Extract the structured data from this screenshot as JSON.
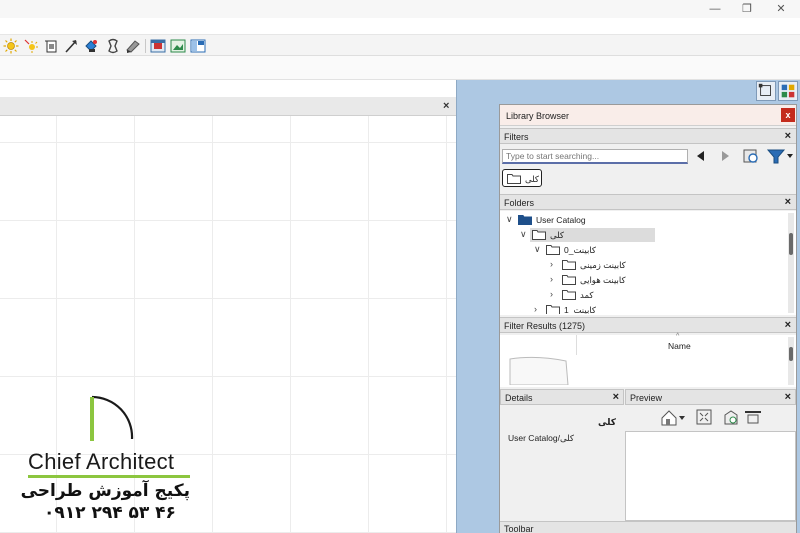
{
  "window": {
    "minimize_glyph": "—",
    "maximize_glyph": "❐",
    "close_glyph": "✕"
  },
  "toolbar": {
    "icons": [
      "sun-light-icon",
      "spot-light-icon",
      "camera-add-icon",
      "arrow-pointer-icon",
      "paint-bucket-icon",
      "material-eyedropper-icon",
      "pencil-ruler-icon",
      "render-view-icon",
      "image-view-icon",
      "layout-view-icon"
    ]
  },
  "drawing": {
    "close_glyph": "×"
  },
  "library": {
    "title": "Library Browser",
    "close_glyph": "x",
    "filters": {
      "label": "Filters",
      "search_placeholder": "Type to start searching...",
      "chip_label": "کلی"
    },
    "folders": {
      "label": "Folders",
      "items": [
        {
          "label": "User Catalog",
          "caret": "∨"
        },
        {
          "label": "کلی",
          "caret": "∨"
        },
        {
          "label": "کابینت_0",
          "caret": "∨"
        },
        {
          "label": "کابینت زمینی",
          "caret": "›"
        },
        {
          "label": "کابینت هوایی",
          "caret": "›"
        },
        {
          "label": "کمد",
          "caret": "›"
        },
        {
          "label": "کابینت_1",
          "caret": "›"
        }
      ]
    },
    "results": {
      "label": "Filter Results (1275)",
      "column_name": "Name",
      "sort_glyph": "^"
    },
    "details": {
      "label": "Details",
      "title": "کلی",
      "path": "User Catalog/کلی"
    },
    "preview": {
      "label": "Preview"
    },
    "toolbar_label": "Toolbar"
  },
  "logo": {
    "brand": "Chief Architect",
    "subtitle": "پکیج آموزش طراحی",
    "phone": "۰۹۱۲ ۲۹۴ ۵۳ ۴۶"
  },
  "colors": {
    "accent_green": "#8cc63f",
    "workspace_blue": "#adc8e3",
    "close_red": "#c42b1c"
  }
}
